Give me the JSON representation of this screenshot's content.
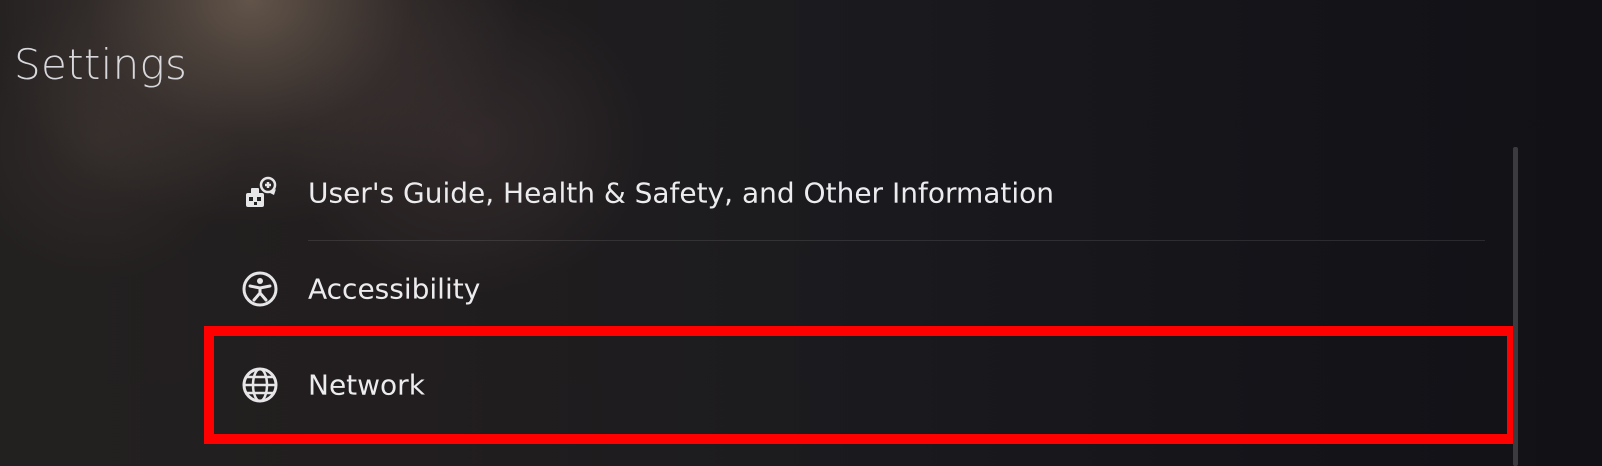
{
  "page": {
    "title": "Settings"
  },
  "menu": {
    "items": [
      {
        "label": "User's Guide, Health & Safety, and Other Information",
        "icon": "users-guide-icon"
      },
      {
        "label": "Accessibility",
        "icon": "accessibility-icon"
      },
      {
        "label": "Network",
        "icon": "globe-icon",
        "highlighted": true
      }
    ]
  },
  "colors": {
    "highlight": "#ff0000",
    "text": "#ececef"
  }
}
